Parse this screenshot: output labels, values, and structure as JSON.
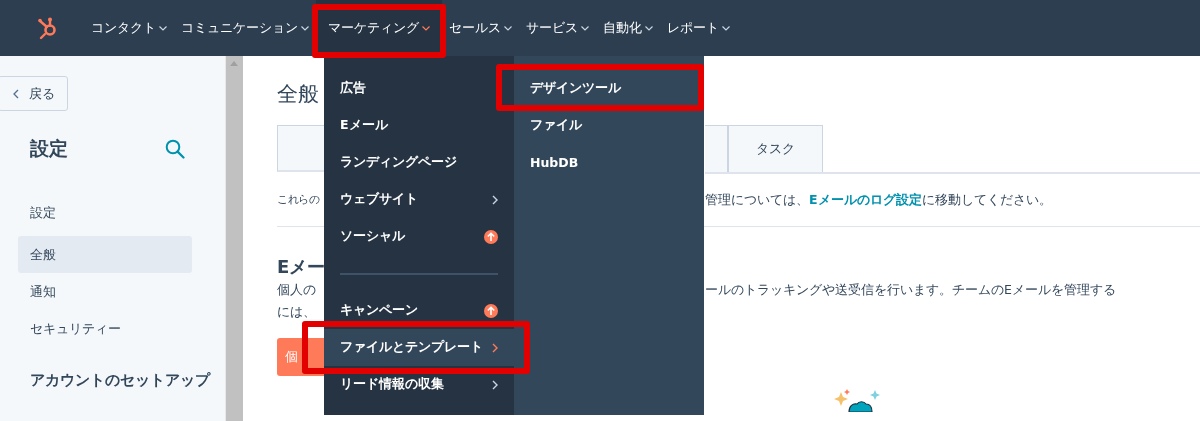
{
  "nav": {
    "items": [
      {
        "label": "コンタクト",
        "selected": false,
        "highlighted": false
      },
      {
        "label": "コミュニケーション",
        "selected": false,
        "highlighted": false
      },
      {
        "label": "マーケティング",
        "selected": true,
        "highlighted": true
      },
      {
        "label": "セールス",
        "selected": false,
        "highlighted": false
      },
      {
        "label": "サービス",
        "selected": false,
        "highlighted": false
      },
      {
        "label": "自動化",
        "selected": false,
        "highlighted": false
      },
      {
        "label": "レポート",
        "selected": false,
        "highlighted": false
      }
    ]
  },
  "sidebar": {
    "back_button": "戻る",
    "title": "設定",
    "items": [
      {
        "kind": "heading",
        "label": "設定"
      },
      {
        "kind": "item",
        "label": "全般",
        "selected": true
      },
      {
        "kind": "item",
        "label": "通知",
        "selected": false
      },
      {
        "kind": "item",
        "label": "セキュリティー",
        "selected": false
      },
      {
        "kind": "heading",
        "label": "アカウントのセットアップ"
      }
    ]
  },
  "main": {
    "title": "全般",
    "tab": "タスク",
    "notice_left": "これらの",
    "notice_right": {
      "before": "管理については、",
      "link": "Eメールのログ設定",
      "after": "に移動してください。"
    },
    "section_heading": "Eメー",
    "description_left": [
      "個人の",
      "には、"
    ],
    "description_right": [
      "ールのトラッキングや送受信を行います。チームのEメールを管理する"
    ],
    "button": "個"
  },
  "menu": {
    "items": [
      {
        "kind": "link",
        "label": "広告",
        "selected": false,
        "highlighted": false
      },
      {
        "kind": "link",
        "label": "Eメール",
        "selected": false,
        "highlighted": false
      },
      {
        "kind": "link",
        "label": "ランディングページ",
        "selected": false,
        "highlighted": false
      },
      {
        "kind": "submenu",
        "label": "ウェブサイト",
        "selected": false,
        "highlighted": false
      },
      {
        "kind": "upgrade",
        "label": "ソーシャル",
        "selected": false,
        "highlighted": false
      },
      {
        "kind": "divider"
      },
      {
        "kind": "upgrade",
        "label": "キャンペーン",
        "selected": false,
        "highlighted": false
      },
      {
        "kind": "submenu",
        "label": "ファイルとテンプレート",
        "selected": true,
        "highlighted": true
      },
      {
        "kind": "submenu",
        "label": "リード情報の収集",
        "selected": false,
        "highlighted": false
      }
    ],
    "submenu_items": [
      {
        "label": "デザインツール",
        "highlighted": true
      },
      {
        "label": "ファイル",
        "highlighted": false
      },
      {
        "label": "HubDB",
        "highlighted": false
      }
    ]
  }
}
